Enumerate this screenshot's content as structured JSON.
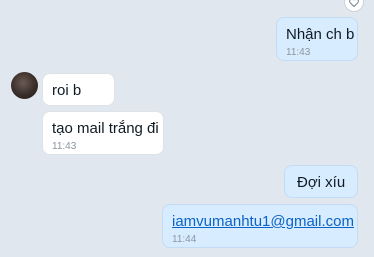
{
  "messages": [
    {
      "id": "m1",
      "side": "outgoing",
      "text": "Nhận ch b",
      "time": "11:43"
    },
    {
      "id": "m2",
      "side": "incoming",
      "text": "roi b",
      "time": ""
    },
    {
      "id": "m3",
      "side": "incoming",
      "text": "tạo mail trắng đi",
      "time": "11:43"
    },
    {
      "id": "m4",
      "side": "outgoing",
      "text": "Đợi xíu",
      "time": ""
    },
    {
      "id": "m5",
      "side": "outgoing",
      "text": "iamvumanhtu1@gmail.com",
      "time": "11:44",
      "is_link": true
    }
  ],
  "icons": {
    "top_right": "heart-icon",
    "avatar": "contact-avatar"
  },
  "colors": {
    "background": "#e1e7ee",
    "outgoing_bubble": "#d8ecff",
    "incoming_bubble": "#ffffff",
    "link": "#0a63c9",
    "timestamp": "#8a96a3"
  }
}
